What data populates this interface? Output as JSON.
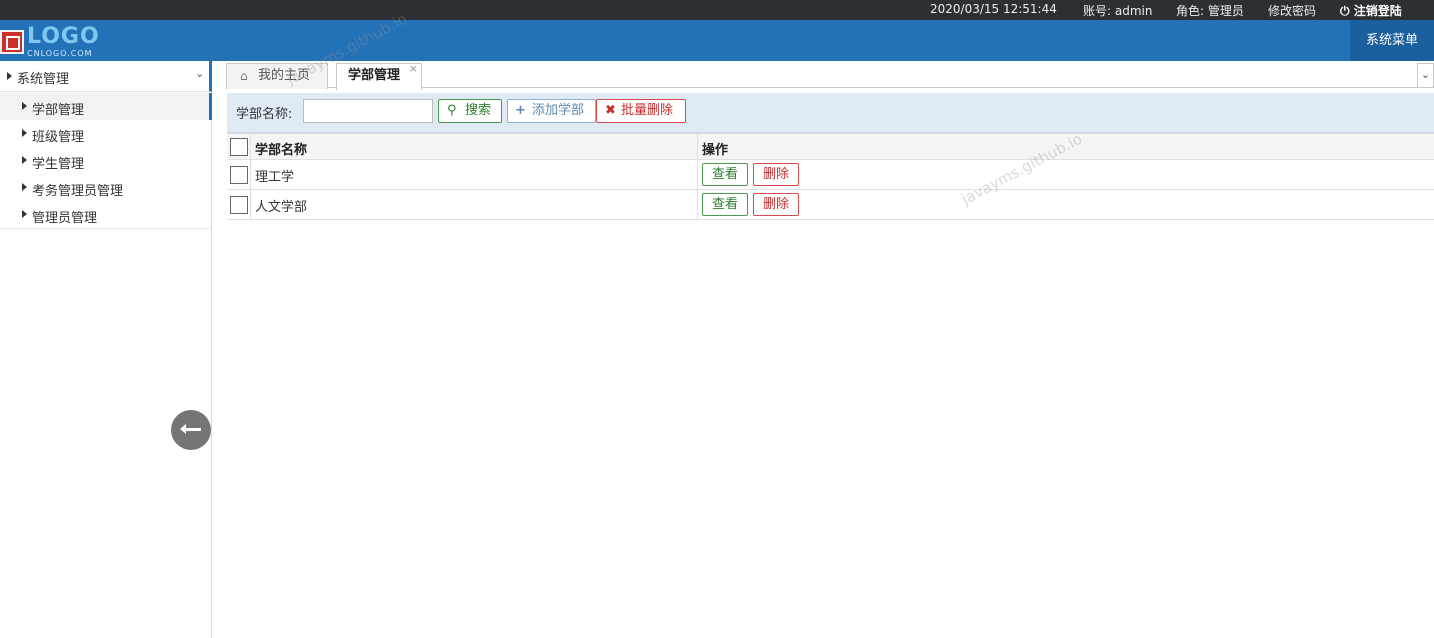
{
  "topbar": {
    "datetime": "2020/03/15 12:51:44",
    "account": "账号: admin",
    "role": "角色: 管理员",
    "change_password": "修改密码",
    "logout": "注销登陆"
  },
  "header": {
    "logo_text": "LOGO",
    "logo_sub": "CNLOGO.COM",
    "system_menu": "系统菜单"
  },
  "sidebar": {
    "root": "系统管理",
    "items": [
      {
        "label": "学部管理",
        "active": true
      },
      {
        "label": "班级管理"
      },
      {
        "label": "学生管理"
      },
      {
        "label": "考务管理员管理"
      },
      {
        "label": "管理员管理"
      }
    ]
  },
  "tabs": [
    {
      "label": "我的主页",
      "icon": "home-icon"
    },
    {
      "label": "学部管理",
      "active": true,
      "closable": true
    }
  ],
  "toolbar": {
    "search_label": "学部名称:",
    "search_value": "",
    "search_button": "搜索",
    "add_button": "添加学部",
    "batch_delete_button": "批量删除"
  },
  "table": {
    "columns": [
      "学部名称",
      "操作"
    ],
    "rows": [
      {
        "name": "理工学",
        "view": "查看",
        "delete": "删除"
      },
      {
        "name": "人文学部",
        "view": "查看",
        "delete": "删除"
      }
    ]
  },
  "watermark": "javayms.github.io",
  "colors": {
    "header": "#2371b7",
    "topbar": "#2c2f33",
    "toolbar": "#dfeaf4",
    "success": "#2f7d2f",
    "danger": "#c52d2d"
  }
}
